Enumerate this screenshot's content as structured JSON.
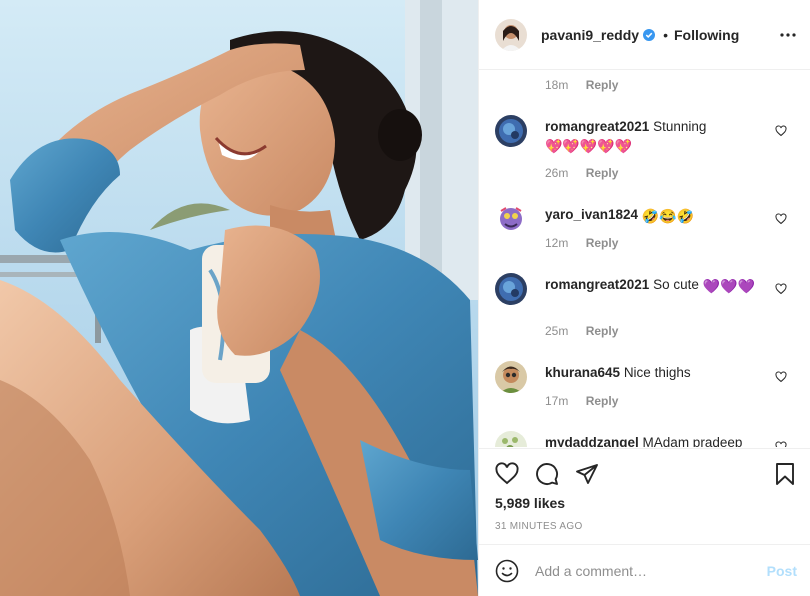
{
  "post": {
    "image_alt": "Woman in denim shirt laughing with a mug",
    "author": {
      "username": "pavani9_reddy",
      "verified": true,
      "follow_status": "Following"
    },
    "first_comment_meta": {
      "time": "18m",
      "reply_label": "Reply"
    },
    "comments": [
      {
        "user": "romangreat2021",
        "text": "Stunning",
        "emoji": "💖💖💖💖💖",
        "time": "26m",
        "reply_label": "Reply"
      },
      {
        "user": "yaro_ivan1824",
        "text": "",
        "emoji": "🤣😂🤣",
        "time": "12m",
        "reply_label": "Reply"
      },
      {
        "user": "romangreat2021",
        "text": "So cute",
        "emoji": "💜💜💜",
        "time": "25m",
        "reply_label": "Reply"
      },
      {
        "user": "khurana645",
        "text": "Nice thighs",
        "emoji": "",
        "time": "17m",
        "reply_label": "Reply"
      },
      {
        "user": "mydaddzangel",
        "text": "MAdam pradeep",
        "emoji": "",
        "time": "",
        "reply_label": ""
      }
    ],
    "likes": "5,989 likes",
    "posted": "31 MINUTES AGO",
    "add_comment": {
      "placeholder": "Add a comment…",
      "post_label": "Post"
    }
  },
  "icons": {
    "more": "more-horizontal-icon",
    "like": "heart-icon",
    "comment": "comment-bubble-icon",
    "share": "paper-plane-icon",
    "save": "bookmark-icon",
    "emoji": "smiley-icon",
    "verified": "verified-badge-icon"
  },
  "colors": {
    "verified_blue": "#3897f0",
    "post_button_disabled": "#b2dffc",
    "meta_gray": "#8e8e8e"
  }
}
